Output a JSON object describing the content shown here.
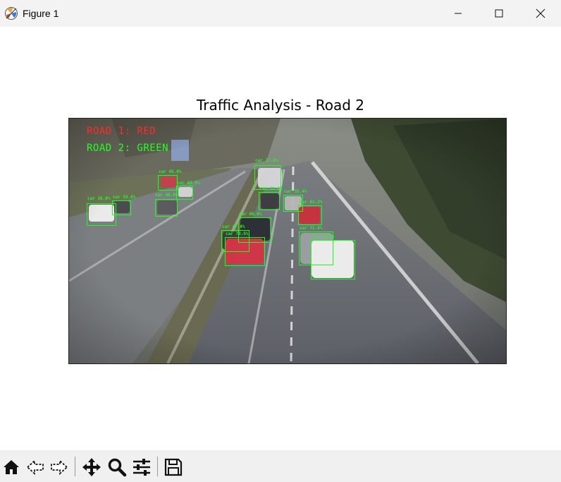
{
  "window": {
    "title": "Figure 1"
  },
  "figure": {
    "title": "Traffic Analysis - Road 2",
    "overlay": {
      "road1": "ROAD 1: RED",
      "road2": "ROAD 2: GREEN"
    },
    "detections": [
      {
        "label": "car 27.8%"
      },
      {
        "label": "car 45.0%"
      },
      {
        "label": "car 43.5%"
      },
      {
        "label": "car 48.0%"
      },
      {
        "label": "car 38.0%"
      },
      {
        "label": "car 53.6%"
      },
      {
        "label": "car 32.8%"
      },
      {
        "label": "car 35.4%"
      },
      {
        "label": "car 61.2%"
      },
      {
        "label": "car 66.0%"
      },
      {
        "label": "car 47.4%"
      },
      {
        "label": "car 70.5%"
      },
      {
        "label": "car 72.6%"
      },
      {
        "label": "car 79.8%"
      }
    ],
    "colors": {
      "road1": "#ff2a2a",
      "road2": "#22ff22",
      "box": "#19ff19"
    }
  },
  "toolbar": {
    "buttons": [
      {
        "name": "home",
        "icon": "home-icon"
      },
      {
        "name": "back",
        "icon": "arrow-left-icon"
      },
      {
        "name": "forward",
        "icon": "arrow-right-icon"
      },
      {
        "name": "pan",
        "icon": "move-icon"
      },
      {
        "name": "zoom",
        "icon": "magnifier-icon"
      },
      {
        "name": "configure",
        "icon": "sliders-icon"
      },
      {
        "name": "save",
        "icon": "save-icon"
      }
    ]
  }
}
